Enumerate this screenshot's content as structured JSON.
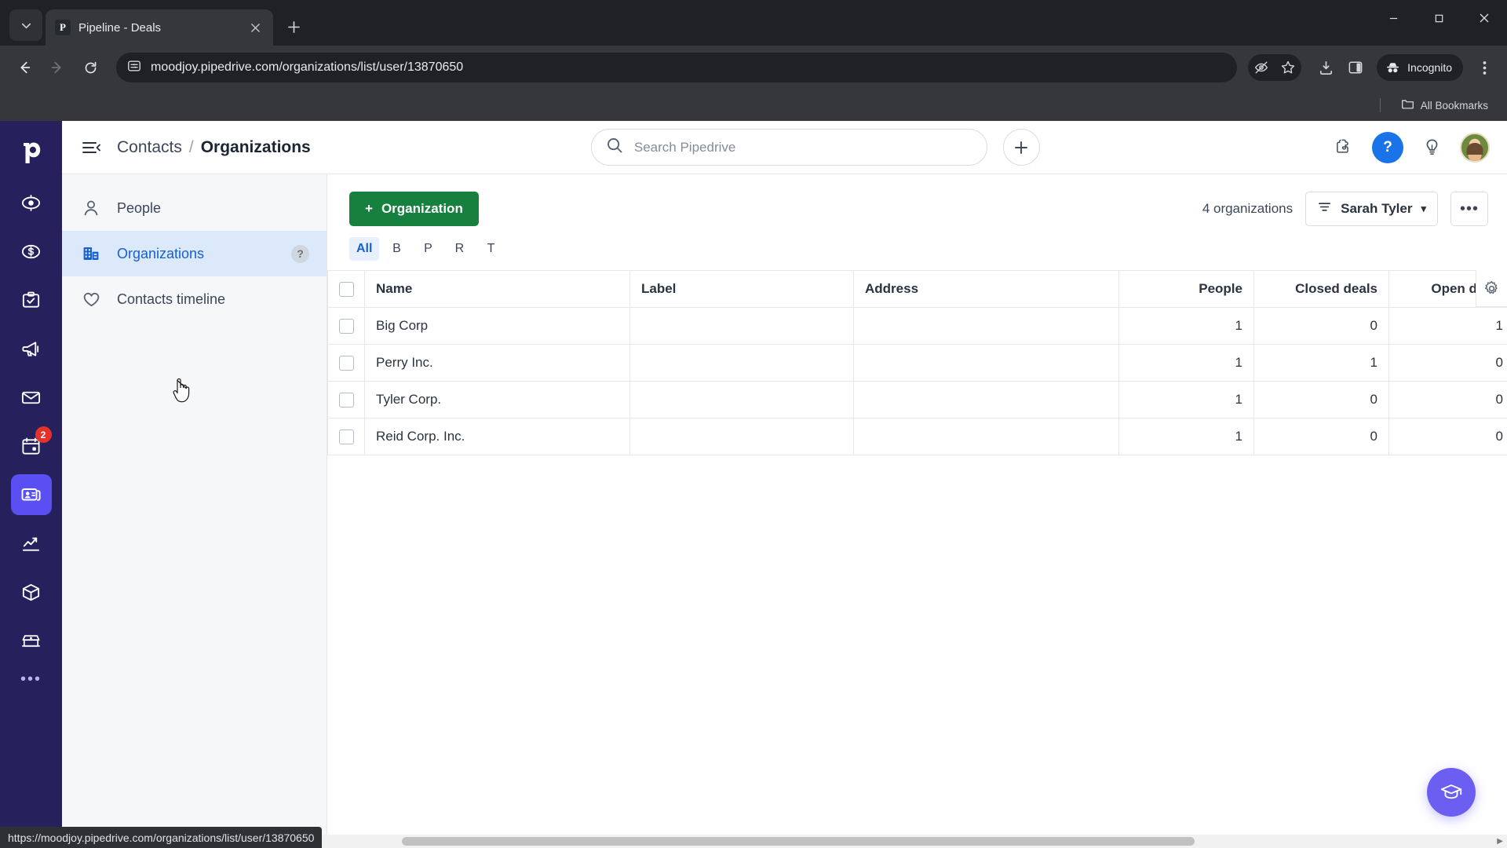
{
  "browser": {
    "tab": {
      "title": "Pipeline - Deals",
      "favicon_letter": "P",
      "close_icon": "close-icon"
    },
    "new_tab_label": "+",
    "tab_search_icon": "chevron-down-icon",
    "window_controls": {
      "minimize": "—",
      "maximize": "▢",
      "close": "✕"
    },
    "nav": {
      "back_icon": "arrow-left-icon",
      "forward_icon": "arrow-right-icon",
      "reload_icon": "reload-icon"
    },
    "omnibox": {
      "site_info_icon": "page-info-icon",
      "url": "moodjoy.pipedrive.com/organizations/list/user/13870650"
    },
    "toolbar_icons": [
      "eye-off-icon",
      "star-icon",
      "download-icon",
      "side-panel-icon"
    ],
    "incognito_label": "Incognito",
    "menu_icon": "three-dot-menu-icon",
    "bookmarks": {
      "all_bookmarks_label": "All Bookmarks",
      "folder_icon": "folder-icon"
    },
    "status_url": "https://moodjoy.pipedrive.com/organizations/list/user/13870650"
  },
  "rail": {
    "logo": "pipedrive-logo",
    "items": [
      {
        "name": "leads-icon",
        "badge": ""
      },
      {
        "name": "deals-icon",
        "badge": ""
      },
      {
        "name": "activities-icon",
        "badge": ""
      },
      {
        "name": "campaigns-icon",
        "badge": ""
      },
      {
        "name": "mail-icon",
        "badge": ""
      },
      {
        "name": "calendar-icon",
        "badge": "2"
      },
      {
        "name": "contacts-icon",
        "badge": ""
      },
      {
        "name": "insights-icon",
        "badge": ""
      },
      {
        "name": "products-icon",
        "badge": ""
      },
      {
        "name": "marketplace-icon",
        "badge": ""
      }
    ],
    "more_label": "•••"
  },
  "header": {
    "hamburger_icon": "collapse-menu-icon",
    "breadcrumb_parent": "Contacts",
    "breadcrumb_separator": "/",
    "breadcrumb_current": "Organizations",
    "search": {
      "placeholder": "Search Pipedrive",
      "value": "",
      "icon": "search-icon"
    },
    "add_button_label": "+",
    "right_icons": [
      {
        "name": "apps-puzzle-icon",
        "label": ""
      },
      {
        "name": "help-icon",
        "label": "?"
      },
      {
        "name": "lightbulb-icon",
        "label": ""
      }
    ],
    "avatar_name": "user-avatar"
  },
  "subnav": {
    "items": [
      {
        "label": "People",
        "icon": "person-icon",
        "active": false,
        "has_help": false
      },
      {
        "label": "Organizations",
        "icon": "organization-icon",
        "active": true,
        "has_help": true
      },
      {
        "label": "Contacts timeline",
        "icon": "heart-icon",
        "active": false,
        "has_help": false
      }
    ],
    "help_glyph": "?"
  },
  "content": {
    "add_button": {
      "label": "Organization",
      "plus": "+"
    },
    "count_text": "4 organizations",
    "filter": {
      "label": "Sarah Tyler",
      "filter_icon": "filter-icon",
      "chevron": "▾"
    },
    "more_button_label": "•••",
    "alpha_filters": [
      {
        "label": "All",
        "active": true
      },
      {
        "label": "B",
        "active": false
      },
      {
        "label": "P",
        "active": false
      },
      {
        "label": "R",
        "active": false
      },
      {
        "label": "T",
        "active": false
      }
    ],
    "table": {
      "columns": [
        "Name",
        "Label",
        "Address",
        "People",
        "Closed deals",
        "Open deals"
      ],
      "settings_icon": "gear-icon",
      "rows": [
        {
          "name": "Big Corp",
          "label": "",
          "address": "",
          "people": "1",
          "closed_deals": "0",
          "open_deals": "1"
        },
        {
          "name": "Perry Inc.",
          "label": "",
          "address": "",
          "people": "1",
          "closed_deals": "1",
          "open_deals": "0"
        },
        {
          "name": "Tyler Corp.",
          "label": "",
          "address": "",
          "people": "1",
          "closed_deals": "0",
          "open_deals": "0"
        },
        {
          "name": "Reid Corp. Inc.",
          "label": "",
          "address": "",
          "people": "1",
          "closed_deals": "0",
          "open_deals": "0"
        }
      ]
    }
  },
  "fab": {
    "name": "academy-graduation-cap-icon"
  },
  "colors": {
    "brand_navy": "#26215c",
    "accent_purple": "#5a4ff3",
    "primary_green": "#17803f",
    "link_blue": "#1760cf",
    "badge_red": "#e4322b"
  }
}
